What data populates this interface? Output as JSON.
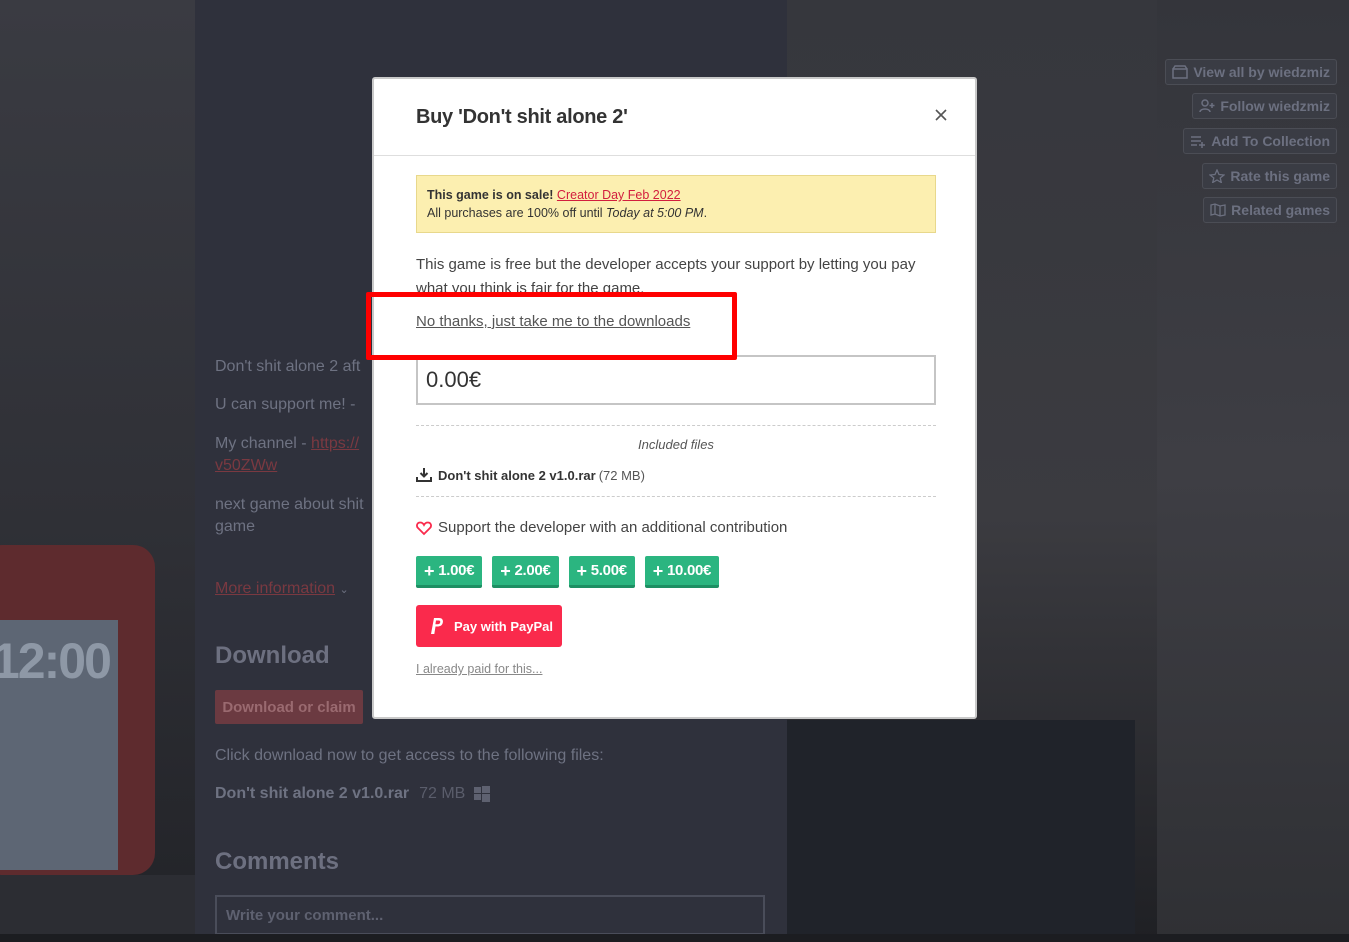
{
  "background": {
    "description_lines": [
      "Don't shit alone 2 aft",
      "U can support me! -",
      "My channel - ",
      "next game about shit",
      "game"
    ],
    "channel_link": "https://",
    "channel_link_cont": "v50ZWw",
    "more_info": "More information",
    "download_heading": "Download",
    "download_button": "Download or claim",
    "download_note": "Click download now to get access to the following files:",
    "file_name": "Don't shit alone 2 v1.0.rar",
    "file_size": "72 MB",
    "comments_heading": "Comments",
    "comment_placeholder": "Write your comment...",
    "phone_time": "12:00",
    "sidebar": {
      "view_all": "View all by wiedzmiz",
      "follow": "Follow wiedzmiz",
      "add_collection": "Add To Collection",
      "rate": "Rate this game",
      "related": "Related games"
    }
  },
  "modal": {
    "title": "Buy 'Don't shit alone 2'",
    "sale": {
      "prefix": "This game is on sale!",
      "link": "Creator Day Feb 2022",
      "line2_prefix": "All purchases are 100% off until ",
      "line2_time": "Today at 5:00 PM",
      "line2_suffix": "."
    },
    "description": "This game is free but the developer accepts your support by letting you pay what you think is fair for the game.",
    "no_thanks": "No thanks, just take me to the downloads",
    "price_value": "0.00€",
    "included_files_label": "Included files",
    "file_name": "Don't shit alone 2 v1.0.rar",
    "file_size": "(72 MB)",
    "support_label": "Support the developer with an additional contribution",
    "amounts": [
      "1.00€",
      "2.00€",
      "5.00€",
      "10.00€"
    ],
    "paypal_label": "Pay with PayPal",
    "already_paid": "I already paid for this..."
  },
  "colors": {
    "accent": "#fa2a4c",
    "amount_button": "#2bb580",
    "highlight": "#ff0000",
    "sale_bg": "#fcefb0"
  },
  "icons": [
    "close-icon",
    "download-icon",
    "heart-icon",
    "paypal-icon",
    "store-icon",
    "follow-icon",
    "collection-icon",
    "star-icon",
    "map-icon",
    "windows-icon"
  ]
}
